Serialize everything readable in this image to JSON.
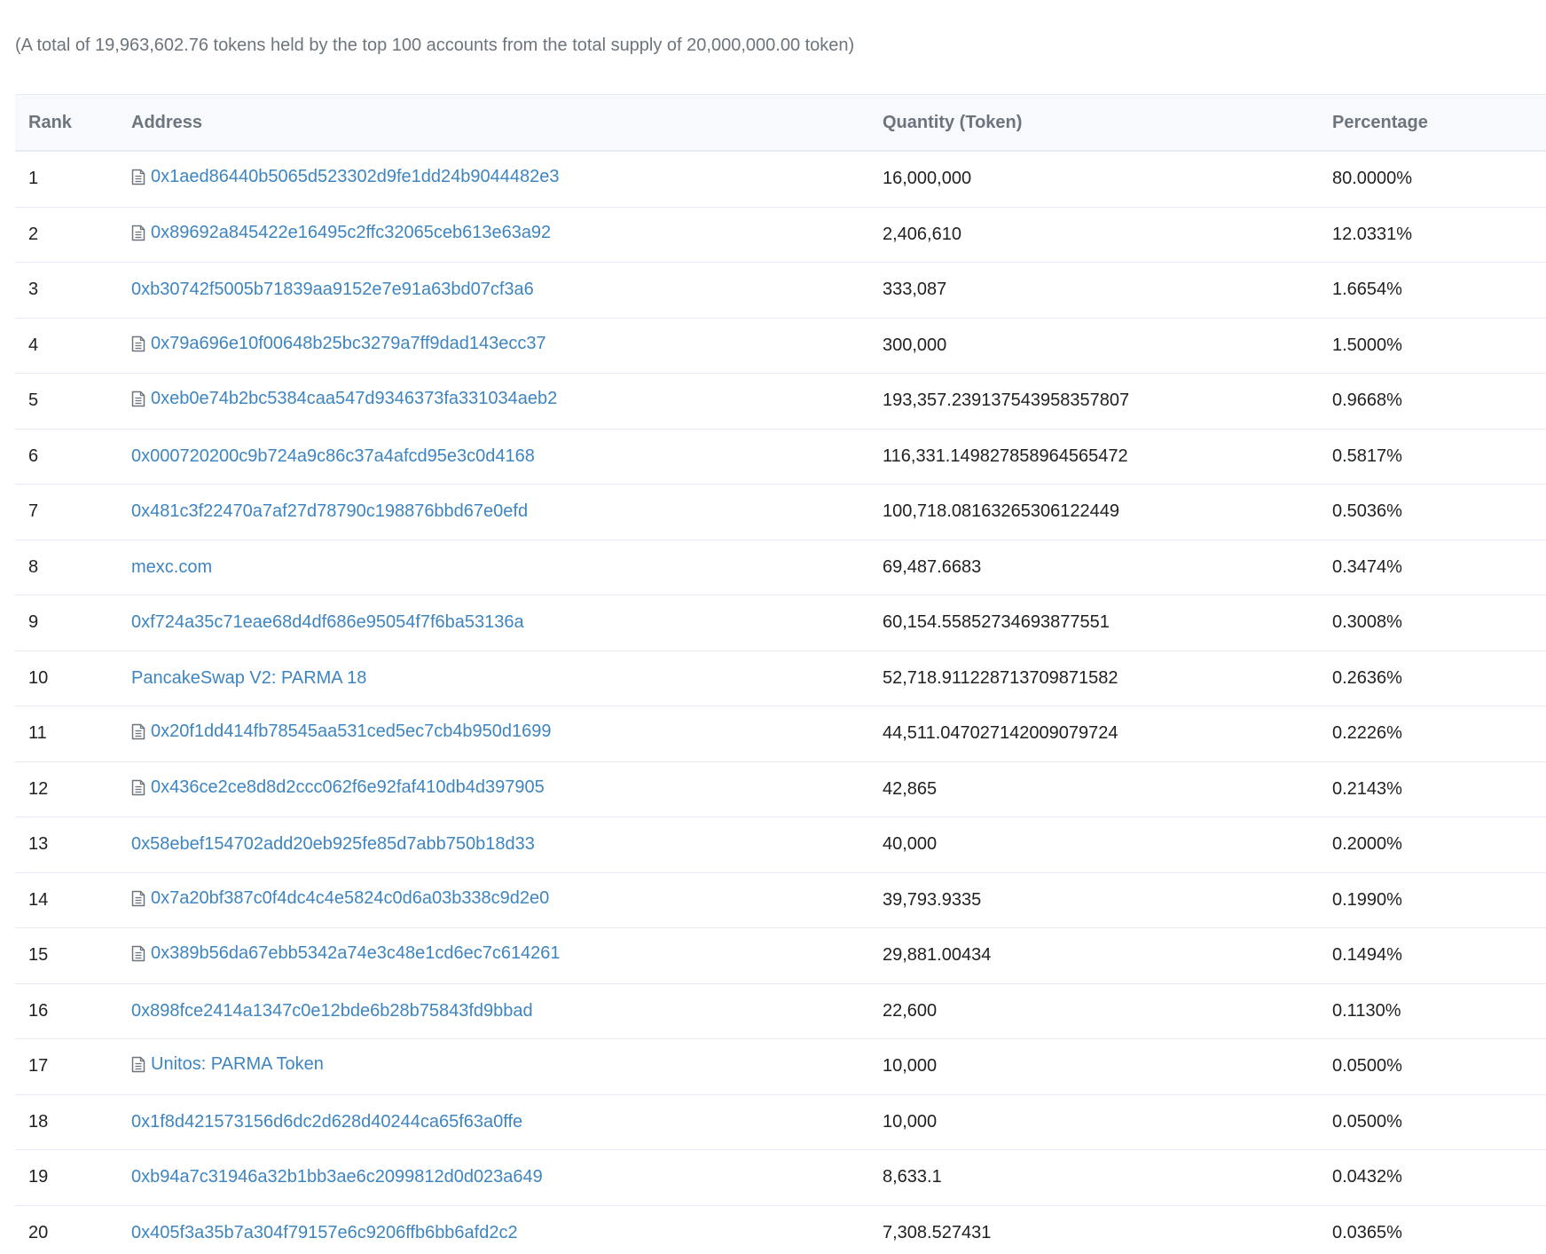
{
  "summary": "(A total of 19,963,602.76 tokens held by the top 100 accounts from the total supply of 20,000,000.00 token)",
  "table": {
    "headers": {
      "rank": "Rank",
      "address": "Address",
      "quantity": "Quantity (Token)",
      "percentage": "Percentage"
    },
    "icon": "contract-file-icon",
    "link_color": "#3e85c0",
    "rows": [
      {
        "rank": "1",
        "address": "0x1aed86440b5065d523302d9fe1dd24b9044482e3",
        "is_contract": true,
        "quantity": "16,000,000",
        "percentage": "80.0000%"
      },
      {
        "rank": "2",
        "address": "0x89692a845422e16495c2ffc32065ceb613e63a92",
        "is_contract": true,
        "quantity": "2,406,610",
        "percentage": "12.0331%"
      },
      {
        "rank": "3",
        "address": "0xb30742f5005b71839aa9152e7e91a63bd07cf3a6",
        "is_contract": false,
        "quantity": "333,087",
        "percentage": "1.6654%"
      },
      {
        "rank": "4",
        "address": "0x79a696e10f00648b25bc3279a7ff9dad143ecc37",
        "is_contract": true,
        "quantity": "300,000",
        "percentage": "1.5000%"
      },
      {
        "rank": "5",
        "address": "0xeb0e74b2bc5384caa547d9346373fa331034aeb2",
        "is_contract": true,
        "quantity": "193,357.239137543958357807",
        "percentage": "0.9668%"
      },
      {
        "rank": "6",
        "address": "0x000720200c9b724a9c86c37a4afcd95e3c0d4168",
        "is_contract": false,
        "quantity": "116,331.149827858964565472",
        "percentage": "0.5817%"
      },
      {
        "rank": "7",
        "address": "0x481c3f22470a7af27d78790c198876bbd67e0efd",
        "is_contract": false,
        "quantity": "100,718.08163265306122449",
        "percentage": "0.5036%"
      },
      {
        "rank": "8",
        "address": "mexc.com",
        "is_contract": false,
        "quantity": "69,487.6683",
        "percentage": "0.3474%"
      },
      {
        "rank": "9",
        "address": "0xf724a35c71eae68d4df686e95054f7f6ba53136a",
        "is_contract": false,
        "quantity": "60,154.55852734693877551",
        "percentage": "0.3008%"
      },
      {
        "rank": "10",
        "address": "PancakeSwap V2: PARMA 18",
        "is_contract": false,
        "quantity": "52,718.911228713709871582",
        "percentage": "0.2636%"
      },
      {
        "rank": "11",
        "address": "0x20f1dd414fb78545aa531ced5ec7cb4b950d1699",
        "is_contract": true,
        "quantity": "44,511.047027142009079724",
        "percentage": "0.2226%"
      },
      {
        "rank": "12",
        "address": "0x436ce2ce8d8d2ccc062f6e92faf410db4d397905",
        "is_contract": true,
        "quantity": "42,865",
        "percentage": "0.2143%"
      },
      {
        "rank": "13",
        "address": "0x58ebef154702add20eb925fe85d7abb750b18d33",
        "is_contract": false,
        "quantity": "40,000",
        "percentage": "0.2000%"
      },
      {
        "rank": "14",
        "address": "0x7a20bf387c0f4dc4c4e5824c0d6a03b338c9d2e0",
        "is_contract": true,
        "quantity": "39,793.9335",
        "percentage": "0.1990%"
      },
      {
        "rank": "15",
        "address": "0x389b56da67ebb5342a74e3c48e1cd6ec7c614261",
        "is_contract": true,
        "quantity": "29,881.00434",
        "percentage": "0.1494%"
      },
      {
        "rank": "16",
        "address": "0x898fce2414a1347c0e12bde6b28b75843fd9bbad",
        "is_contract": false,
        "quantity": "22,600",
        "percentage": "0.1130%"
      },
      {
        "rank": "17",
        "address": "Unitos: PARMA Token",
        "is_contract": true,
        "quantity": "10,000",
        "percentage": "0.0500%"
      },
      {
        "rank": "18",
        "address": "0x1f8d421573156d6dc2d628d40244ca65f63a0ffe",
        "is_contract": false,
        "quantity": "10,000",
        "percentage": "0.0500%"
      },
      {
        "rank": "19",
        "address": "0xb94a7c31946a32b1bb3ae6c2099812d0d023a649",
        "is_contract": false,
        "quantity": "8,633.1",
        "percentage": "0.0432%"
      },
      {
        "rank": "20",
        "address": "0x405f3a35b7a304f79157e6c9206ffb6bb6afd2c2",
        "is_contract": false,
        "quantity": "7,308.527431",
        "percentage": "0.0365%"
      }
    ]
  }
}
